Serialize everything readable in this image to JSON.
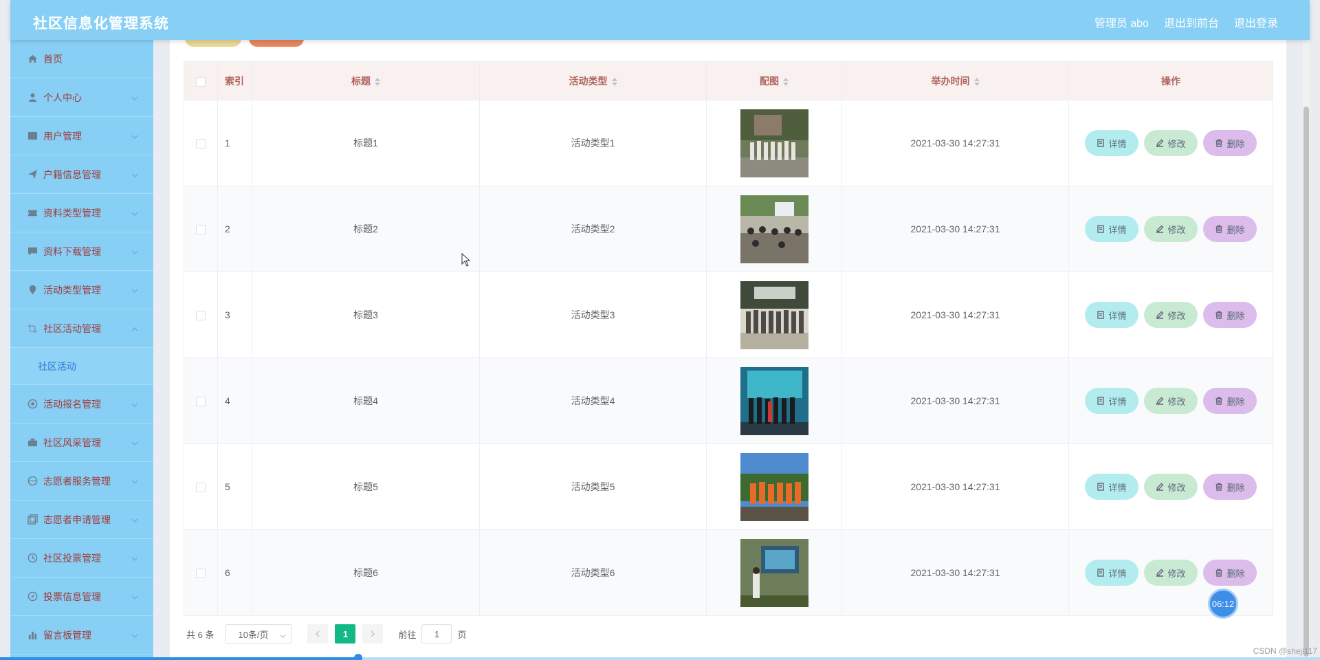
{
  "app": {
    "title": "社区信息化管理系统",
    "user": "管理员 abo",
    "to_front": "退出到前台",
    "logout": "退出登录"
  },
  "sidebar": {
    "items": [
      {
        "label": "首页",
        "icon": "home-icon"
      },
      {
        "label": "个人中心",
        "icon": "user-icon"
      },
      {
        "label": "用户管理",
        "icon": "image-icon"
      },
      {
        "label": "户籍信息管理",
        "icon": "send-icon"
      },
      {
        "label": "资料类型管理",
        "icon": "ticket-icon"
      },
      {
        "label": "资料下载管理",
        "icon": "message-icon"
      },
      {
        "label": "活动类型管理",
        "icon": "location-icon"
      },
      {
        "label": "社区活动管理",
        "icon": "crop-icon"
      },
      {
        "label": "活动报名管理",
        "icon": "target-icon"
      },
      {
        "label": "社区风采管理",
        "icon": "briefcase-icon"
      },
      {
        "label": "志愿者服务管理",
        "icon": "globe-icon"
      },
      {
        "label": "志愿者申请管理",
        "icon": "copy-icon"
      },
      {
        "label": "社区投票管理",
        "icon": "clock-icon"
      },
      {
        "label": "投票信息管理",
        "icon": "compass-icon"
      },
      {
        "label": "留言板管理",
        "icon": "chart-icon"
      }
    ],
    "active_sub": "社区活动"
  },
  "table": {
    "headers": {
      "index": "索引",
      "title": "标题",
      "type": "活动类型",
      "image": "配图",
      "time": "举办时间",
      "ops": "操作"
    },
    "rows": [
      {
        "index": "1",
        "title": "标题1",
        "type": "活动类型1",
        "time": "2021-03-30 14:27:31"
      },
      {
        "index": "2",
        "title": "标题2",
        "type": "活动类型2",
        "time": "2021-03-30 14:27:31"
      },
      {
        "index": "3",
        "title": "标题3",
        "type": "活动类型3",
        "time": "2021-03-30 14:27:31"
      },
      {
        "index": "4",
        "title": "标题4",
        "type": "活动类型4",
        "time": "2021-03-30 14:27:31"
      },
      {
        "index": "5",
        "title": "标题5",
        "type": "活动类型5",
        "time": "2021-03-30 14:27:31"
      },
      {
        "index": "6",
        "title": "标题6",
        "type": "活动类型6",
        "time": "2021-03-30 14:27:31"
      }
    ],
    "btn_detail": "详情",
    "btn_edit": "修改",
    "btn_delete": "删除"
  },
  "pager": {
    "total": "共 6 条",
    "page_size": "10条/页",
    "current": "1",
    "goto_label": "前往",
    "goto_value": "1",
    "page_unit": "页"
  },
  "overlay": {
    "timer": "06:12",
    "watermark": "CSDN @sheji117"
  },
  "colors": {
    "header_bg": "#88cff5",
    "sidebar_bg": "#88cff5",
    "menu_text": "#a03b3b",
    "active_sub": "#2f7bd1",
    "pager_current": "#12b886"
  }
}
